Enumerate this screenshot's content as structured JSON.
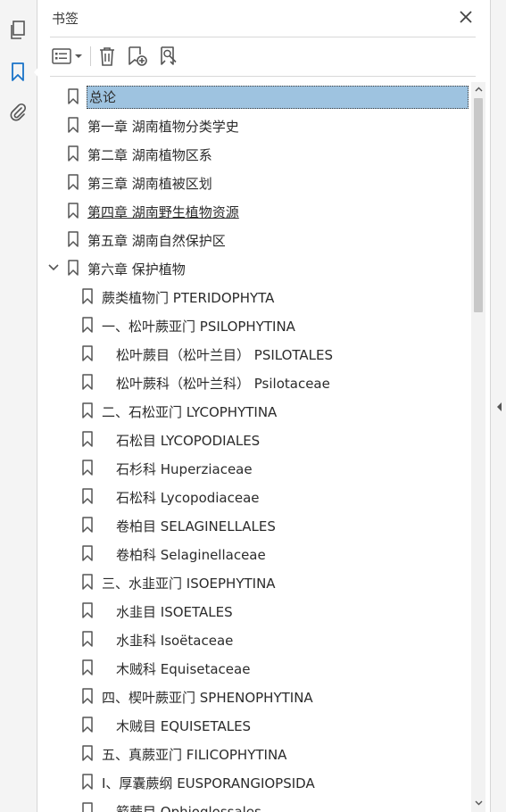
{
  "rail": {
    "icons": [
      "pages-icon",
      "bookmark-icon",
      "attachment-icon"
    ]
  },
  "panel": {
    "title": "书签"
  },
  "tree": [
    {
      "label": "总论",
      "level": 0,
      "selected": true,
      "underline": false,
      "expandable": false
    },
    {
      "label": "第一章 湖南植物分类学史",
      "level": 0,
      "selected": false,
      "underline": false,
      "expandable": false
    },
    {
      "label": "第二章 湖南植物区系",
      "level": 0,
      "selected": false,
      "underline": false,
      "expandable": false
    },
    {
      "label": "第三章 湖南植被区划",
      "level": 0,
      "selected": false,
      "underline": false,
      "expandable": false
    },
    {
      "label": "第四章 湖南野生植物资源",
      "level": 0,
      "selected": false,
      "underline": true,
      "expandable": false
    },
    {
      "label": "第五章 湖南自然保护区",
      "level": 0,
      "selected": false,
      "underline": false,
      "expandable": false
    },
    {
      "label": "第六章 保护植物",
      "level": 0,
      "selected": false,
      "underline": false,
      "expandable": true
    },
    {
      "label": "蕨类植物门 PTERIDOPHYTA",
      "level": 1,
      "selected": false,
      "underline": false,
      "expandable": false
    },
    {
      "label": "一、松叶蕨亚门 PSILOPHYTINA",
      "level": 1,
      "selected": false,
      "underline": false,
      "expandable": false
    },
    {
      "label": "松叶蕨目（松叶兰目） PSILOTALES",
      "level": 2,
      "selected": false,
      "underline": false,
      "expandable": false
    },
    {
      "label": "松叶蕨科（松叶兰科） Psilotaceae",
      "level": 2,
      "selected": false,
      "underline": false,
      "expandable": false
    },
    {
      "label": "二、石松亚门 LYCOPHYTINA",
      "level": 1,
      "selected": false,
      "underline": false,
      "expandable": false
    },
    {
      "label": "石松目 LYCOPODIALES",
      "level": 2,
      "selected": false,
      "underline": false,
      "expandable": false
    },
    {
      "label": "石杉科 Huperziaceae",
      "level": 2,
      "selected": false,
      "underline": false,
      "expandable": false
    },
    {
      "label": "石松科 Lycopodiaceae",
      "level": 2,
      "selected": false,
      "underline": false,
      "expandable": false
    },
    {
      "label": "卷柏目 SELAGINELLALES",
      "level": 2,
      "selected": false,
      "underline": false,
      "expandable": false
    },
    {
      "label": "卷柏科 Selaginellaceae",
      "level": 2,
      "selected": false,
      "underline": false,
      "expandable": false
    },
    {
      "label": "三、水韭亚门 ISOEPHYTINA",
      "level": 1,
      "selected": false,
      "underline": false,
      "expandable": false
    },
    {
      "label": "水韭目 ISOETALES",
      "level": 2,
      "selected": false,
      "underline": false,
      "expandable": false
    },
    {
      "label": "水韭科 Isoëtaceae",
      "level": 2,
      "selected": false,
      "underline": false,
      "expandable": false
    },
    {
      "label": "木贼科 Equisetaceae",
      "level": 2,
      "selected": false,
      "underline": false,
      "expandable": false
    },
    {
      "label": "四、楔叶蕨亚门 SPHENOPHYTINA",
      "level": 1,
      "selected": false,
      "underline": false,
      "expandable": false
    },
    {
      "label": "木贼目 EQUISETALES",
      "level": 2,
      "selected": false,
      "underline": false,
      "expandable": false
    },
    {
      "label": "五、真蕨亚门 FILICOPHYTINA",
      "level": 1,
      "selected": false,
      "underline": false,
      "expandable": false
    },
    {
      "label": "I、厚囊蕨纲 EUSPORANGIOPSIDA",
      "level": 1,
      "selected": false,
      "underline": false,
      "expandable": false
    },
    {
      "label": "箭蕨目 Ophioglossales",
      "level": 2,
      "selected": false,
      "underline": false,
      "expandable": false
    }
  ],
  "colors": {
    "accent": "#1a73c8",
    "selection": "#9ec3e0",
    "icon": "#555555"
  }
}
